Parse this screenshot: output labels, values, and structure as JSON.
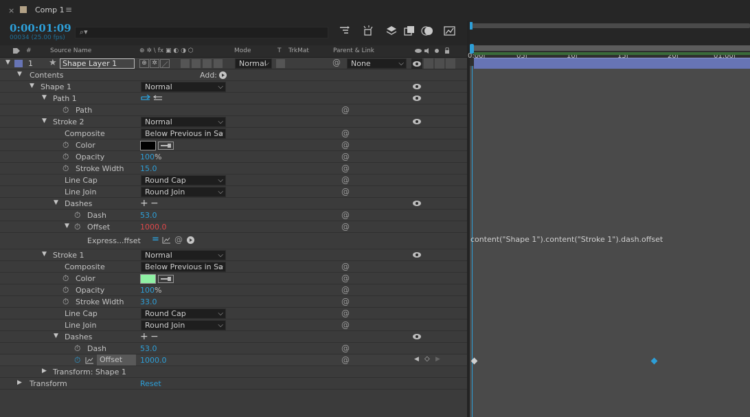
{
  "tab": {
    "close": "×",
    "title": "Comp 1",
    "menu": "≡"
  },
  "timecode": "0:00:01:09",
  "frame_info": "00034 (25.00 fps)",
  "search": {
    "icon": "⌕▾",
    "placeholder": ""
  },
  "toolbar_icons": [
    "transfer-icon",
    "shy-icon",
    "layer-icon",
    "frame-blend-icon",
    "motion-blur-icon",
    "graph-editor-icon"
  ],
  "columns": {
    "tag": "",
    "num": "#",
    "source": "Source Name",
    "switches": "⊕ ✲ \\ fx ▣ ◐ ◑ ⬡",
    "mode": "Mode",
    "t": "T",
    "trkmat": "TrkMat",
    "parent": "Parent & Link"
  },
  "layer": {
    "number": "1",
    "name": "Shape Layer 1",
    "mode": "Normal",
    "parent": "None"
  },
  "contents_add": "Add:",
  "tree": [
    {
      "id": "contents",
      "label": "Contents"
    },
    {
      "id": "shape1",
      "label": "Shape 1",
      "mode": "Normal"
    },
    {
      "id": "path1",
      "label": "Path 1"
    },
    {
      "id": "path",
      "label": "Path"
    },
    {
      "id": "stroke2",
      "label": "Stroke 2",
      "mode": "Normal"
    },
    {
      "id": "composite2",
      "label": "Composite",
      "value": "Below Previous in Sa"
    },
    {
      "id": "color2",
      "label": "Color"
    },
    {
      "id": "opacity2",
      "label": "Opacity",
      "value": "100",
      "unit": "%"
    },
    {
      "id": "strokewidth2",
      "label": "Stroke Width",
      "value": "15.0"
    },
    {
      "id": "linecap2",
      "label": "Line Cap",
      "value": "Round Cap"
    },
    {
      "id": "linejoin2",
      "label": "Line Join",
      "value": "Round Join"
    },
    {
      "id": "dashes2",
      "label": "Dashes"
    },
    {
      "id": "dash2",
      "label": "Dash",
      "value": "53.0"
    },
    {
      "id": "offset2",
      "label": "Offset",
      "value": "1000.0"
    },
    {
      "id": "express",
      "label": "Express...ffset"
    },
    {
      "id": "stroke1",
      "label": "Stroke 1",
      "mode": "Normal"
    },
    {
      "id": "composite1",
      "label": "Composite",
      "value": "Below Previous in Sa"
    },
    {
      "id": "color1",
      "label": "Color"
    },
    {
      "id": "opacity1",
      "label": "Opacity",
      "value": "100",
      "unit": "%"
    },
    {
      "id": "strokewidth1",
      "label": "Stroke Width",
      "value": "33.0"
    },
    {
      "id": "linecap1",
      "label": "Line Cap",
      "value": "Round Cap"
    },
    {
      "id": "linejoin1",
      "label": "Line Join",
      "value": "Round Join"
    },
    {
      "id": "dashes1",
      "label": "Dashes"
    },
    {
      "id": "dash1",
      "label": "Dash",
      "value": "53.0"
    },
    {
      "id": "offset1",
      "label": "Offset",
      "value": "1000.0"
    },
    {
      "id": "transformshape",
      "label": "Transform: Shape 1"
    },
    {
      "id": "transform",
      "label": "Transform",
      "value": "Reset"
    }
  ],
  "colors": {
    "stroke2_color": "#000000",
    "stroke1_color": "#8ff0a4",
    "accent": "#2d9fd8",
    "layer_bar": "#6774b5"
  },
  "ruler_ticks": [
    "0:00f",
    "05f",
    "10f",
    "15f",
    "20f",
    "01:00f"
  ],
  "expression": "content(\"Shape 1\").content(\"Stroke 1\").dash.offset"
}
